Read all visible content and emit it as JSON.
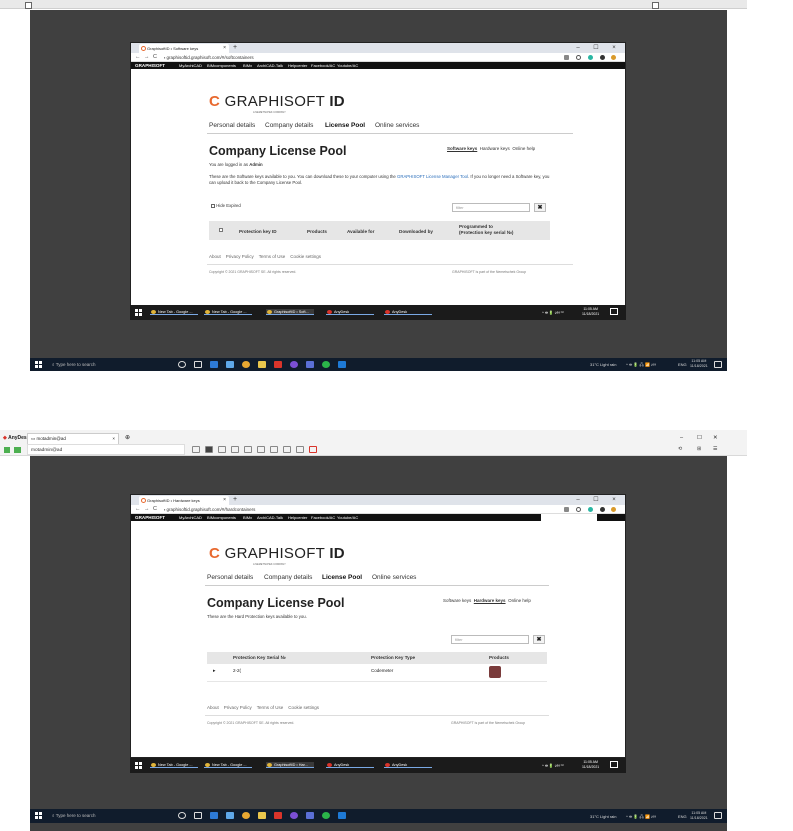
{
  "doc_top": {
    "bar": ""
  },
  "shot1": {
    "tab_title": "GraphisoftID • Software keys",
    "tab_close": "×",
    "new_tab": "+",
    "window_controls": [
      "–",
      "☐",
      "×"
    ],
    "nav_icons": [
      "←",
      "→",
      "C"
    ],
    "lock": "🔒",
    "url": "graphisoftid.graphisoft.com/#/softcontainers",
    "bookmarks_brand": "GRAPHISOFT",
    "bookmarks": [
      "MyArchiCAD",
      "BIMcomponents",
      "BIMx",
      "ArchiCAD-Talk",
      "Helpcenter",
      "Facebook/AC",
      "Youtube/AC"
    ],
    "logo_text": "GRAPHISOFT",
    "logo_suffix": "ID",
    "logo_sub": "A NEMETSCHEK COMPANY",
    "nav": [
      "Personal details",
      "Company details",
      "License Pool",
      "Online services"
    ],
    "title": "Company License Pool",
    "sublinks": [
      "Software keys",
      "Hardware keys",
      "Online help"
    ],
    "logged_prefix": "You are logged in as",
    "logged_user": "Admin",
    "desc1": "These are the Software keys available to you. You can download these to your computer using the",
    "desc_link": "GRAPHISOFT License Manager Tool",
    "desc2": ". If you no longer",
    "desc3": "need a Software key, you can upload it back to the Company License Pool.",
    "hide_expired": "Hide Expired",
    "filter_placeholder": "filter",
    "clear": "✖",
    "columns": [
      "Protection key ID",
      "Products",
      "Available for",
      "Downloaded by",
      "Programmed to",
      "(Protection key serial №)"
    ],
    "footer_links": [
      "About",
      "Privacy Policy",
      "Terms of Use",
      "Cookie settings"
    ],
    "copyright": "Copyright © 2021 GRAPHISOFT SE. All rights reserved.",
    "part_of": "GRAPHISOFT is part of the Nemetschek Group",
    "inner_tasks": [
      "New Tab - Google ...",
      "New Tab - Google ...",
      "GraphisoftID • Soft...",
      "AnyDesk",
      "AnyDesk"
    ],
    "inner_tray": "^ ⛯ 🔋 🕬 ⁽¹⁾",
    "inner_time": "11:05 AM",
    "inner_date": "11/18/2021",
    "search_placeholder": "Type here to search",
    "weather": "31°C  Light rain",
    "tray_icons": "^ ⛯ 🔋 🖧 📶 🕬",
    "lang": "ENG",
    "time": "11:05 AM",
    "date": "11/18/2021"
  },
  "anydesk": {
    "app_tab": "AnyDesk",
    "remote_tab": "motadmin@ad",
    "tab_close": "×",
    "remote_name": "motadmin@ad",
    "win_controls": [
      "–",
      "☐",
      "✕"
    ],
    "right_icons": [
      "⟲",
      "⊞",
      "☰"
    ]
  },
  "shot2": {
    "tab_title": "GraphisoftID • Hardware keys",
    "tab_close": "×",
    "new_tab": "+",
    "window_controls": [
      "–",
      "☐",
      "×"
    ],
    "nav_icons": [
      "←",
      "→",
      "C"
    ],
    "url": "graphisoftid.graphisoft.com/#/hardcontainers",
    "bookmarks_brand": "GRAPHISOFT",
    "bookmarks": [
      "MyArchiCAD",
      "BIMcomponents",
      "BIMx",
      "ArchiCAD-Talk",
      "Helpcenter",
      "Facebook/AC",
      "Youtube/AC"
    ],
    "logo_text": "GRAPHISOFT",
    "logo_suffix": "ID",
    "logo_sub": "A NEMETSCHEK COMPANY",
    "nav": [
      "Personal details",
      "Company details",
      "License Pool",
      "Online services"
    ],
    "title": "Company License Pool",
    "sublinks": [
      "Software keys",
      "Hardware keys",
      "Online help"
    ],
    "desc": "These are the Hard Protection keys available to you.",
    "filter_placeholder": "filter",
    "clear": "✖",
    "columns": [
      "Protection Key Serial №",
      "Protection Key Type",
      "Products"
    ],
    "row": {
      "expand": "▸",
      "serial": "2-2(",
      "type": "Codemeter"
    },
    "footer_links": [
      "About",
      "Privacy Policy",
      "Terms of Use",
      "Cookie settings"
    ],
    "copyright": "Copyright © 2021 GRAPHISOFT SE. All rights reserved.",
    "part_of": "GRAPHISOFT is part of the Nemetschek Group",
    "inner_tasks": [
      "New Tab - Google ...",
      "New Tab - Google ...",
      "GraphisoftID • Har...",
      "AnyDesk",
      "AnyDesk"
    ],
    "inner_time": "11:05 AM",
    "inner_date": "11/18/2021",
    "search_placeholder": "Type here to search",
    "weather": "31°C  Light rain",
    "tray_icons": "^ ⛯ 🔋 🖧 📶 🕬",
    "lang": "ENG",
    "time": "11:05 AM",
    "date": "11/18/2021"
  },
  "colors": {
    "brand": "#e8692f",
    "desktop": "#404040",
    "taskbar": "#101c2c",
    "link": "#2a6ebb"
  }
}
